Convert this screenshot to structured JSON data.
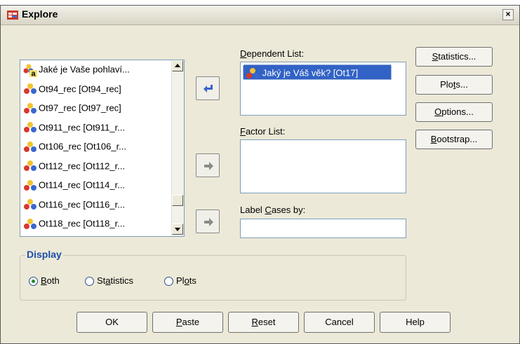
{
  "window": {
    "title": "Explore",
    "close_symbol": "×"
  },
  "source_list": {
    "items": [
      {
        "label": "Jaké je Vaše pohlaví...",
        "icon": "nominal-string-variable-icon"
      },
      {
        "label": "Ot94_rec [Ot94_rec]",
        "icon": "nominal-variable-icon"
      },
      {
        "label": "Ot97_rec [Ot97_rec]",
        "icon": "nominal-variable-icon"
      },
      {
        "label": "Ot911_rec [Ot911_r...",
        "icon": "nominal-variable-icon"
      },
      {
        "label": "Ot106_rec [Ot106_r...",
        "icon": "nominal-variable-icon"
      },
      {
        "label": "Ot112_rec [Ot112_r...",
        "icon": "nominal-variable-icon"
      },
      {
        "label": "Ot114_rec [Ot114_r...",
        "icon": "nominal-variable-icon"
      },
      {
        "label": "Ot116_rec [Ot116_r...",
        "icon": "nominal-variable-icon"
      },
      {
        "label": "Ot118_rec [Ot118_r...",
        "icon": "nominal-variable-icon"
      }
    ]
  },
  "dependent_list": {
    "label_pre": "",
    "label_key": "D",
    "label_post": "ependent List:",
    "items": [
      {
        "label": "Jaký je Váš věk? [Ot17]"
      }
    ]
  },
  "factor_list": {
    "label_key": "F",
    "label_post": "actor List:"
  },
  "label_cases": {
    "label_pre": "Label ",
    "label_key": "C",
    "label_post": "ases by:",
    "value": ""
  },
  "side_buttons": {
    "statistics": {
      "pre": "",
      "key": "S",
      "post": "tatistics..."
    },
    "plots": {
      "pre": "Plo",
      "key": "t",
      "post": "s..."
    },
    "options": {
      "pre": "",
      "key": "O",
      "post": "ptions..."
    },
    "bootstrap": {
      "pre": "",
      "key": "B",
      "post": "ootstrap..."
    }
  },
  "display": {
    "title": "Display",
    "options": [
      {
        "pre": "",
        "key": "B",
        "post": "oth",
        "selected": true
      },
      {
        "pre": "St",
        "key": "a",
        "post": "tistics",
        "selected": false
      },
      {
        "pre": "Pl",
        "key": "o",
        "post": "ts",
        "selected": false
      }
    ]
  },
  "bottom_buttons": {
    "ok": {
      "pre": "OK",
      "key": "",
      "post": ""
    },
    "paste": {
      "pre": "",
      "key": "P",
      "post": "aste"
    },
    "reset": {
      "pre": "",
      "key": "R",
      "post": "eset"
    },
    "cancel": {
      "pre": "Cancel",
      "key": "",
      "post": ""
    },
    "help": {
      "pre": "Help",
      "key": "",
      "post": ""
    }
  },
  "colors": {
    "selection": "#3162c5",
    "group_title": "#1a4fa8",
    "dialog_bg": "#ece9d8",
    "arrow_active": "#3a63c9"
  }
}
